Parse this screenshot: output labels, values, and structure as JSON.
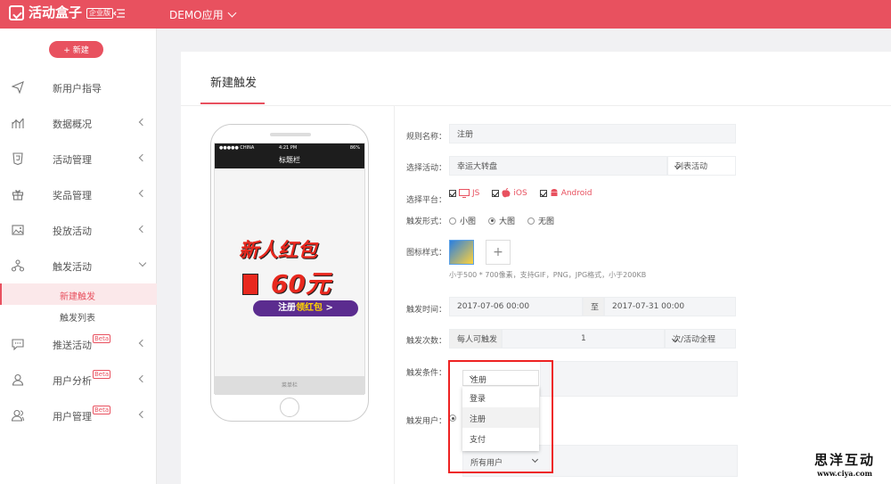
{
  "topbar": {
    "logo_text": "活动盒子",
    "logo_badge": "企业版",
    "app_name": "DEMO应用"
  },
  "sidebar": {
    "new_button": "+ 新建",
    "items": [
      {
        "label": "新用户指导",
        "icon": "paper-plane-icon"
      },
      {
        "label": "数据概况",
        "icon": "chart-icon"
      },
      {
        "label": "活动管理",
        "icon": "html5-icon"
      },
      {
        "label": "奖品管理",
        "icon": "gift-icon"
      },
      {
        "label": "投放活动",
        "icon": "image-icon"
      },
      {
        "label": "触发活动",
        "icon": "hierarchy-icon"
      },
      {
        "label": "推送活动",
        "icon": "chat-icon",
        "badge": "Beta"
      },
      {
        "label": "用户分析",
        "icon": "user-icon",
        "badge": "Beta"
      },
      {
        "label": "用户管理",
        "icon": "users-icon",
        "badge": "Beta"
      }
    ],
    "sub_items": [
      {
        "label": "新建触发"
      },
      {
        "label": "触发列表"
      }
    ]
  },
  "main": {
    "tab": "新建触发",
    "phone": {
      "carrier": "●●●●● CHINA",
      "time": "4:21 PM",
      "battery": "86%",
      "navbar_title": "标题栏",
      "menubar": "菜单栏",
      "art_line1": "新人红包",
      "art_line2": "60元",
      "art_cta_pre": "注册",
      "art_cta_em": "领红包",
      "art_cta_post": " >"
    },
    "form": {
      "rule_name_label": "规则名称：",
      "rule_name_value": "注册",
      "activity_label": "选择活动：",
      "activity_value": "幸运大转盘",
      "activity_list": "列表活动",
      "platform_label": "选择平台：",
      "platforms": [
        "JS",
        "iOS",
        "Android"
      ],
      "form_label": "触发形式：",
      "form_options": [
        "小图",
        "大图",
        "无图"
      ],
      "icon_label": "图标样式：",
      "icon_add": "+",
      "icon_hint": "小于500 * 700像素，支持GIF，PNG，JPG格式，小于200KB",
      "time_label": "触发时间：",
      "time_start": "2017-07-06 00:00",
      "time_to": "至",
      "time_end": "2017-07-31 00:00",
      "count_label": "触发次数：",
      "count_prefix": "每人可触发",
      "count_value": "1",
      "count_unit": "次/活动全程",
      "condition_label": "触发条件：",
      "condition_selected": "注册",
      "condition_options": [
        "登录",
        "注册",
        "支付"
      ],
      "user_label": "触发用户：",
      "user_select": "所有用户"
    }
  },
  "watermark": {
    "line1": "思洋互动",
    "line2": "www.ciya.com"
  }
}
